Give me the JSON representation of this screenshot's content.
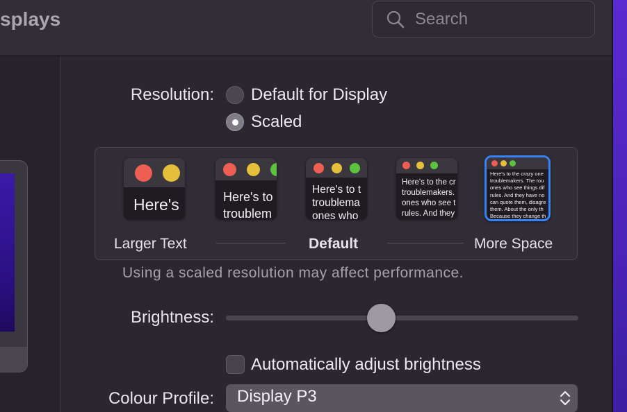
{
  "window": {
    "title": "splays"
  },
  "search": {
    "placeholder": "Search"
  },
  "resolution": {
    "label": "Resolution:",
    "options": [
      {
        "label": "Default for Display",
        "selected": false
      },
      {
        "label": "Scaled",
        "selected": true
      }
    ]
  },
  "scaled_options": {
    "thumbnails": [
      {
        "text": "Here's"
      },
      {
        "text": "Here's to troublem"
      },
      {
        "text": "Here's to t troublema ones who"
      },
      {
        "text": "Here's to the cr troublemakers. ones who see t rules. And they"
      },
      {
        "text": "Here's to the crazy one troublemakers. The rou ones who see things dif rules. And they have no can quote them, disagre them. About the only th Because they change th",
        "selected": true
      }
    ],
    "labels": {
      "left": "Larger Text",
      "center": "Default",
      "right": "More Space"
    }
  },
  "note": "Using a scaled resolution may affect performance.",
  "brightness": {
    "label": "Brightness:",
    "value": 0.44
  },
  "auto_brightness": {
    "label": "Automatically adjust brightness",
    "checked": false
  },
  "colour_profile": {
    "label": "Colour Profile:",
    "value": "Display P3"
  },
  "colors": {
    "selection": "#3a82f7",
    "traffic_red": "#ee5e52",
    "traffic_yellow": "#e5be3a",
    "traffic_green": "#5dc23e"
  }
}
